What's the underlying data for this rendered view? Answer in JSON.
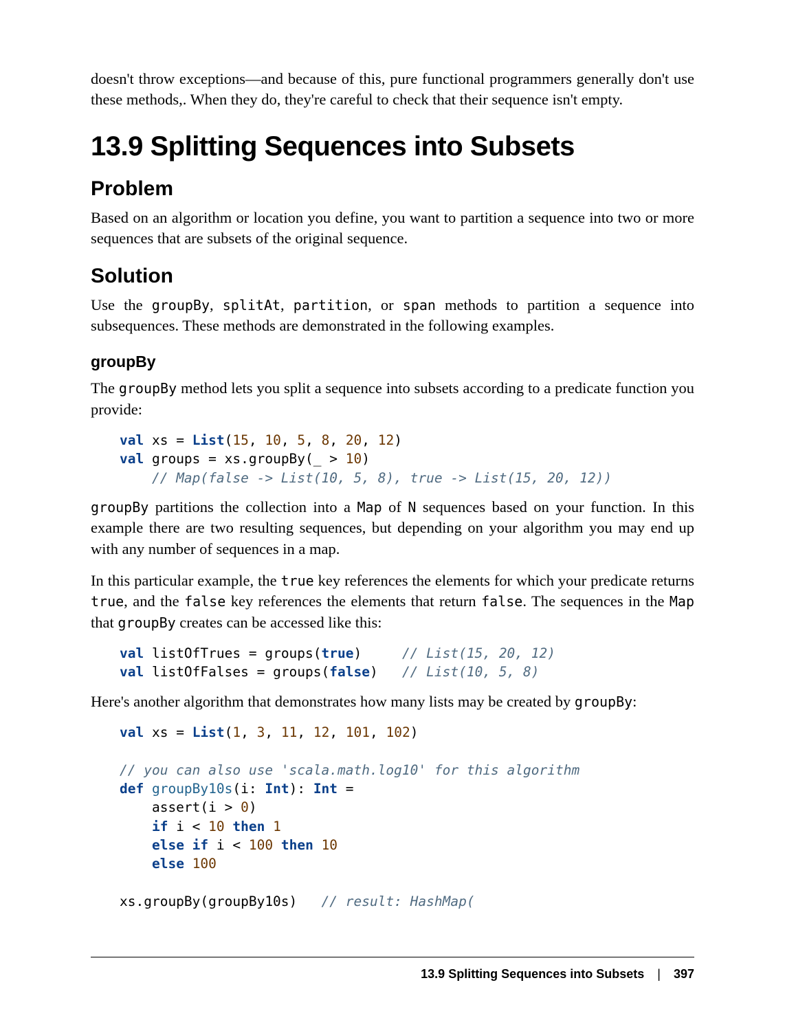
{
  "intro_para": "doesn't throw exceptions—and because of this, pure functional programmers generally don't use these methods,. When they do, they're careful to check that their sequence isn't empty.",
  "section_title": "13.9 Splitting Sequences into Subsets",
  "problem": {
    "heading": "Problem",
    "text": "Based on an algorithm or location you define, you want to partition a sequence into two or more sequences that are subsets of the original sequence."
  },
  "solution": {
    "heading": "Solution",
    "text_before": "Use the ",
    "m1": "groupBy",
    "m2": "splitAt",
    "m3": "partition",
    "m4": "span",
    "text_after": " methods to partition a sequence into subsequences. These methods are demonstrated in the following examples."
  },
  "groupBy": {
    "heading": "groupBy",
    "para1_a": "The ",
    "para1_m": "groupBy",
    "para1_b": " method lets you split a sequence into subsets according to a predicate function you provide:",
    "code1": {
      "l1_kw": "val",
      "l1_a": " xs = ",
      "l1_type": "List",
      "l1_b": "(",
      "l1_n1": "15",
      "l1_c": ", ",
      "l1_n2": "10",
      "l1_d": ", ",
      "l1_n3": "5",
      "l1_e": ", ",
      "l1_n4": "8",
      "l1_f": ", ",
      "l1_n5": "20",
      "l1_g": ", ",
      "l1_n6": "12",
      "l1_h": ")",
      "l2_kw": "val",
      "l2_a": " groups = xs.groupBy(_ > ",
      "l2_n": "10",
      "l2_b": ")",
      "l3_cmt": "// Map(false -> List(10, 5, 8), true -> List(15, 20, 12))"
    },
    "para2_a": "groupBy",
    "para2_b": " partitions the collection into a ",
    "para2_c": "Map",
    "para2_d": " of ",
    "para2_e": "N",
    "para2_f": " sequences based on your function. In this example there are two resulting sequences, but depending on your algorithm you may end up with any number of sequences in a map.",
    "para3_a": "In this particular example, the ",
    "para3_b": "true",
    "para3_c": " key references the elements for which your predicate returns ",
    "para3_d": "true",
    "para3_e": ", and the ",
    "para3_f": "false",
    "para3_g": " key references the elements that return ",
    "para3_h": "false",
    "para3_i": ". The sequences in the ",
    "para3_j": "Map",
    "para3_k": " that ",
    "para3_l": "groupBy",
    "para3_m": " creates can be accessed like this:",
    "code2": {
      "l1_kw": "val",
      "l1_a": " listOfTrues = groups(",
      "l1_bool": "true",
      "l1_b": ")     ",
      "l1_cmt": "// List(15, 20, 12)",
      "l2_kw": "val",
      "l2_a": " listOfFalses = groups(",
      "l2_bool": "false",
      "l2_b": ")   ",
      "l2_cmt": "// List(10, 5, 8)"
    },
    "para4_a": "Here's another algorithm that demonstrates how many lists may be created by ",
    "para4_b": "groupBy",
    "para4_c": ":",
    "code3": {
      "l1_kw": "val",
      "l1_a": " xs = ",
      "l1_type": "List",
      "l1_b": "(",
      "l1_n1": "1",
      "l1_c": ", ",
      "l1_n2": "3",
      "l1_d": ", ",
      "l1_n3": "11",
      "l1_e": ", ",
      "l1_n4": "12",
      "l1_f": ", ",
      "l1_n5": "101",
      "l1_g": ", ",
      "l1_n6": "102",
      "l1_h": ")",
      "l3_cmt": "// you can also use 'scala.math.log10' for this algorithm",
      "l4_kw": "def",
      "l4_fn": " groupBy10s",
      "l4_a": "(i: ",
      "l4_type1": "Int",
      "l4_b": "): ",
      "l4_type2": "Int",
      "l4_c": " =",
      "l5_a": "    assert(i > ",
      "l5_n": "0",
      "l5_b": ")",
      "l6_a": "    ",
      "l6_kw1": "if",
      "l6_b": " i < ",
      "l6_n1": "10",
      "l6_c": " ",
      "l6_kw2": "then",
      "l6_d": " ",
      "l6_n2": "1",
      "l7_a": "    ",
      "l7_kw1": "else if",
      "l7_b": " i < ",
      "l7_n1": "100",
      "l7_c": " ",
      "l7_kw2": "then",
      "l7_d": " ",
      "l7_n2": "10",
      "l8_a": "    ",
      "l8_kw": "else",
      "l8_b": " ",
      "l8_n": "100",
      "l10_a": "xs.groupBy(groupBy10s)   ",
      "l10_cmt": "// result: HashMap("
    }
  },
  "footer": {
    "section": "13.9 Splitting Sequences into Subsets",
    "sep": "|",
    "page": "397"
  }
}
